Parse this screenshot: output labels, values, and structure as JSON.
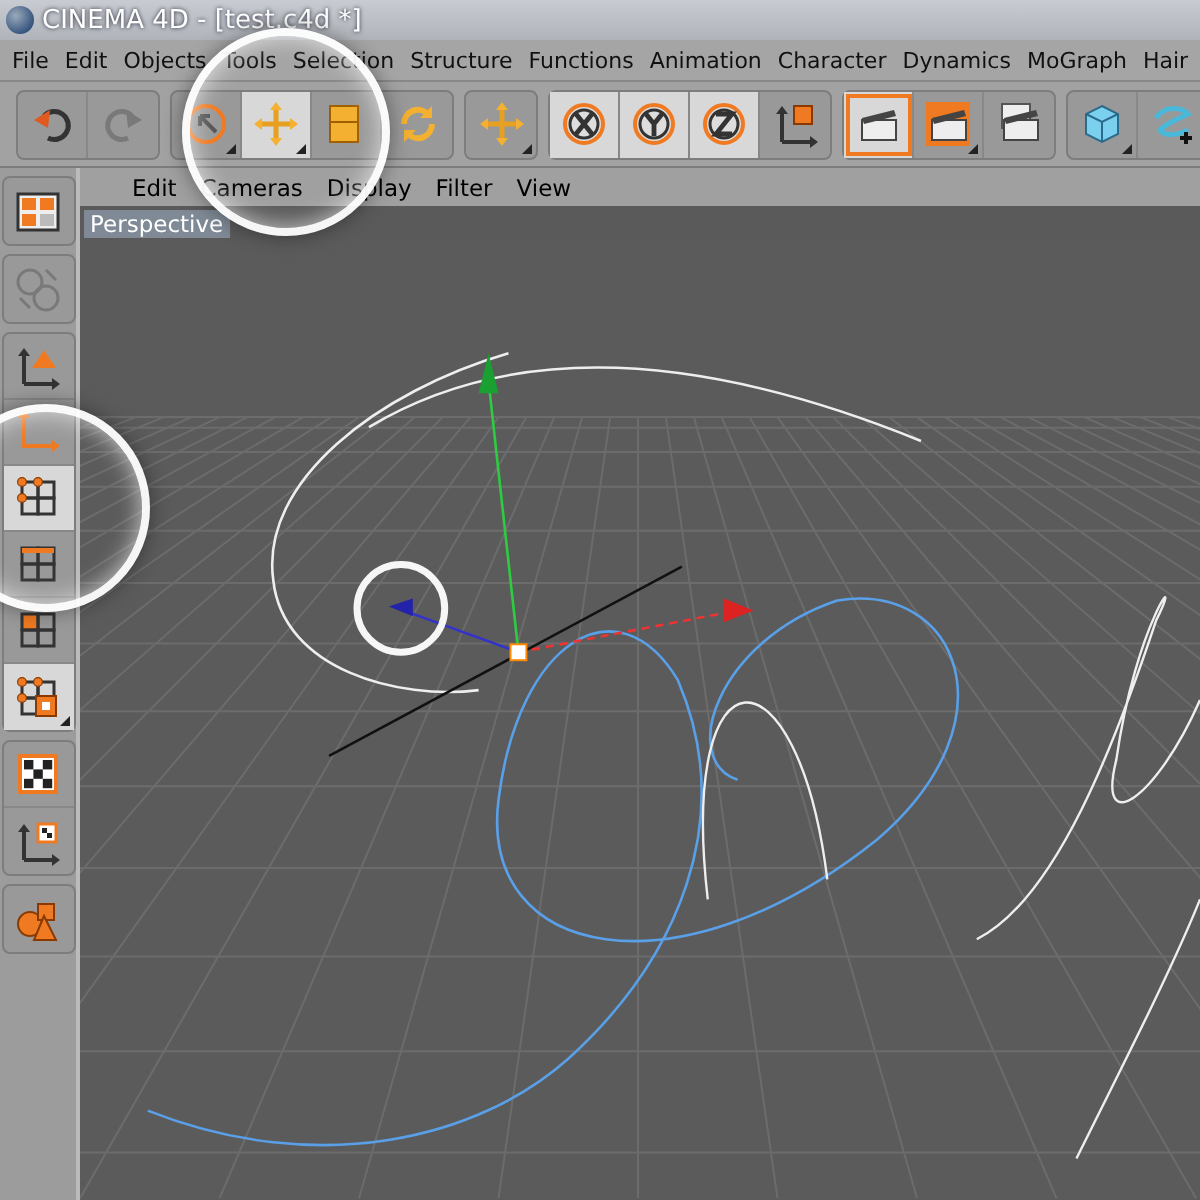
{
  "window": {
    "title": "CINEMA 4D - [test.c4d *]"
  },
  "menu": [
    "File",
    "Edit",
    "Objects",
    "Tools",
    "Selection",
    "Structure",
    "Functions",
    "Animation",
    "Character",
    "Dynamics",
    "MoGraph",
    "Hair"
  ],
  "toolbar": [
    {
      "buttons": [
        {
          "kind": "undo",
          "selected": false,
          "disabled": false,
          "spotlight": false
        },
        {
          "kind": "redo",
          "selected": false,
          "disabled": true,
          "spotlight": false
        }
      ]
    },
    {
      "buttons": [
        {
          "kind": "select",
          "selected": false,
          "disabled": false,
          "spotlight": false
        },
        {
          "kind": "move",
          "selected": true,
          "disabled": false,
          "spotlight": true
        },
        {
          "kind": "scale",
          "selected": false,
          "disabled": false,
          "spotlight": false
        },
        {
          "kind": "rotate",
          "selected": false,
          "disabled": false,
          "spotlight": false
        }
      ]
    },
    {
      "buttons": [
        {
          "kind": "move",
          "selected": false,
          "disabled": false,
          "spotlight": false
        }
      ]
    },
    {
      "buttons": [
        {
          "kind": "x",
          "selected": true,
          "disabled": false,
          "spotlight": false
        },
        {
          "kind": "y",
          "selected": true,
          "disabled": false,
          "spotlight": false
        },
        {
          "kind": "z",
          "selected": true,
          "disabled": false,
          "spotlight": false
        },
        {
          "kind": "coord",
          "selected": false,
          "disabled": false,
          "spotlight": false
        }
      ]
    },
    {
      "buttons": [
        {
          "kind": "render-view",
          "selected": true,
          "disabled": false,
          "spotlight": false
        },
        {
          "kind": "render-pv",
          "selected": false,
          "disabled": false,
          "spotlight": false
        },
        {
          "kind": "render-settings",
          "selected": false,
          "disabled": false,
          "spotlight": false
        }
      ]
    },
    {
      "buttons": [
        {
          "kind": "cube",
          "selected": false,
          "disabled": false,
          "spotlight": false
        },
        {
          "kind": "pen",
          "selected": false,
          "disabled": false,
          "spotlight": false
        }
      ]
    }
  ],
  "sidebar": [
    {
      "buttons": [
        {
          "kind": "layout",
          "selected": false,
          "disabled": false,
          "spotlight": false
        }
      ]
    },
    {
      "buttons": [
        {
          "kind": "convert",
          "selected": false,
          "disabled": true,
          "spotlight": false
        }
      ]
    },
    {
      "buttons": [
        {
          "kind": "model",
          "selected": false,
          "disabled": false,
          "spotlight": false
        },
        {
          "kind": "axis",
          "selected": false,
          "disabled": false,
          "spotlight": false
        },
        {
          "kind": "points",
          "selected": true,
          "disabled": false,
          "spotlight": true
        },
        {
          "kind": "edges",
          "selected": false,
          "disabled": false,
          "spotlight": false
        },
        {
          "kind": "polygons",
          "selected": false,
          "disabled": false,
          "spotlight": false
        },
        {
          "kind": "uv",
          "selected": true,
          "disabled": false,
          "spotlight": false
        }
      ]
    },
    {
      "buttons": [
        {
          "kind": "texture",
          "selected": false,
          "disabled": false,
          "spotlight": false
        },
        {
          "kind": "texture-axis",
          "selected": false,
          "disabled": false,
          "spotlight": false
        }
      ]
    },
    {
      "buttons": [
        {
          "kind": "primitives",
          "selected": false,
          "disabled": false,
          "spotlight": false
        }
      ]
    }
  ],
  "viewport": {
    "menu": [
      "Edit",
      "Cameras",
      "Display",
      "Filter",
      "View"
    ],
    "title": "Perspective"
  }
}
